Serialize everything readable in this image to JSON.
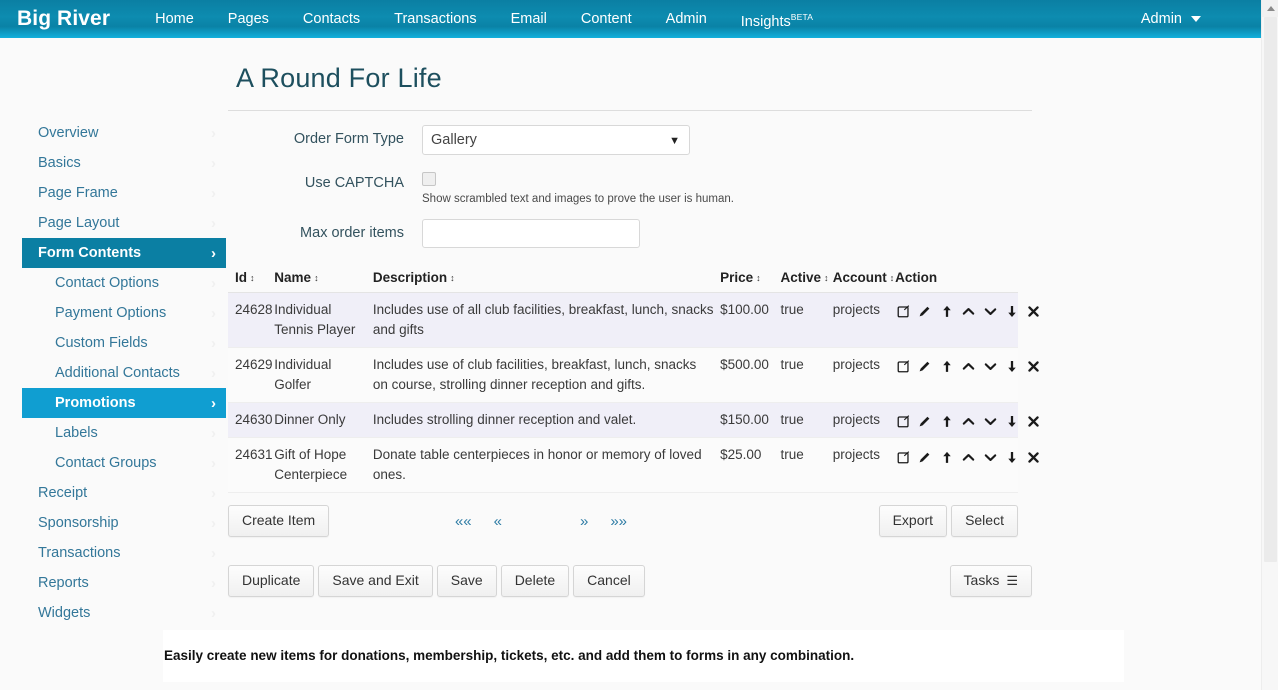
{
  "topnav": {
    "brand": "Big River",
    "links": [
      {
        "label": "Home"
      },
      {
        "label": "Pages"
      },
      {
        "label": "Contacts"
      },
      {
        "label": "Transactions"
      },
      {
        "label": "Email"
      },
      {
        "label": "Content"
      },
      {
        "label": "Admin"
      },
      {
        "label": "Insights",
        "sup": "BETA"
      }
    ],
    "user": "Admin"
  },
  "sidebar": {
    "items": [
      {
        "label": "Overview",
        "level": "top",
        "state": "normal"
      },
      {
        "label": "Basics",
        "level": "top",
        "state": "normal"
      },
      {
        "label": "Page Frame",
        "level": "top",
        "state": "normal"
      },
      {
        "label": "Page Layout",
        "level": "top",
        "state": "normal"
      },
      {
        "label": "Form Contents",
        "level": "top",
        "state": "active"
      },
      {
        "label": "Contact Options",
        "level": "sub",
        "state": "normal"
      },
      {
        "label": "Payment Options",
        "level": "sub",
        "state": "normal"
      },
      {
        "label": "Custom Fields",
        "level": "sub",
        "state": "normal"
      },
      {
        "label": "Additional Contacts",
        "level": "sub",
        "state": "normal"
      },
      {
        "label": "Promotions",
        "level": "sub",
        "state": "active2"
      },
      {
        "label": "Labels",
        "level": "sub",
        "state": "normal"
      },
      {
        "label": "Contact Groups",
        "level": "sub",
        "state": "normal"
      },
      {
        "label": "Receipt",
        "level": "top",
        "state": "normal"
      },
      {
        "label": "Sponsorship",
        "level": "top",
        "state": "normal"
      },
      {
        "label": "Transactions",
        "level": "top",
        "state": "normal"
      },
      {
        "label": "Reports",
        "level": "top",
        "state": "normal"
      },
      {
        "label": "Widgets",
        "level": "top",
        "state": "normal"
      }
    ],
    "chevron": "›"
  },
  "main": {
    "title": "A Round For Life",
    "fields": {
      "order_form_type_label": "Order Form Type",
      "order_form_type_value": "Gallery",
      "order_form_type_options": [
        "Gallery"
      ],
      "use_captcha_label": "Use CAPTCHA",
      "use_captcha_help": "Show scrambled text and images to prove the user is human.",
      "max_order_items_label": "Max order items",
      "max_order_items_value": "",
      "max_order_items_placeholder": ""
    }
  },
  "table": {
    "columns": [
      {
        "label": "Id",
        "sortable": true
      },
      {
        "label": "Name",
        "sortable": true
      },
      {
        "label": "Description",
        "sortable": true
      },
      {
        "label": "Price",
        "sortable": true
      },
      {
        "label": "Active",
        "sortable": true
      },
      {
        "label": "Account",
        "sortable": true
      },
      {
        "label": "Action",
        "sortable": false
      }
    ],
    "sort_glyph": "↕",
    "rows": [
      {
        "id": "24628",
        "name": "Individual Tennis Player",
        "description": "Includes use of all club facilities, breakfast, lunch, snacks and gifts",
        "price": "$100.00",
        "active": "true",
        "account": "projects"
      },
      {
        "id": "24629",
        "name": "Individual Golfer",
        "description": "Includes use of club facilities, breakfast, lunch, snacks on course, strolling dinner reception and gifts.",
        "price": "$500.00",
        "active": "true",
        "account": "projects"
      },
      {
        "id": "24630",
        "name": "Dinner Only",
        "description": "Includes strolling dinner reception and valet.",
        "price": "$150.00",
        "active": "true",
        "account": "projects"
      },
      {
        "id": "24631",
        "name": "Gift of Hope Centerpiece",
        "description": "Donate table centerpieces in honor or memory of loved ones.",
        "price": "$25.00",
        "active": "true",
        "account": "projects"
      }
    ],
    "action_icons": [
      "copy-edit-icon",
      "pencil-icon",
      "move-to-top-icon",
      "move-up-icon",
      "move-down-icon",
      "move-to-bottom-icon",
      "delete-icon"
    ]
  },
  "toolbar": {
    "create_item_label": "Create Item",
    "export_label": "Export",
    "select_label": "Select",
    "pager": {
      "first": "««",
      "prev": "«",
      "next": "»",
      "last": "»»"
    }
  },
  "bottombar": {
    "duplicate_label": "Duplicate",
    "save_and_exit_label": "Save and Exit",
    "save_label": "Save",
    "delete_label": "Delete",
    "cancel_label": "Cancel",
    "tasks_label": "Tasks",
    "tasks_icon": "☰"
  },
  "caption": {
    "text": "Easily create new items for donations, membership, tickets, etc. and add them to forms in any combination."
  },
  "colors": {
    "nav_top": "#0b7fa3",
    "nav_bottom": "#12b0dc",
    "sidebar_link": "#337799",
    "sidebar_active": "#0b7fa3",
    "sidebar_active2": "#109ed1",
    "title": "#1d4f5e",
    "row_odd": "#f0eff8",
    "page_bg": "#fafafa"
  }
}
